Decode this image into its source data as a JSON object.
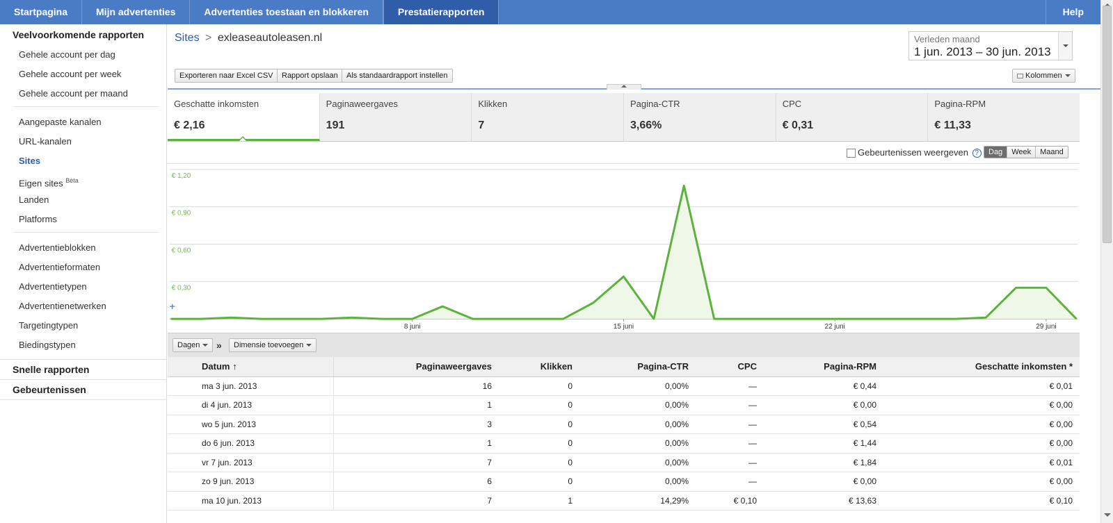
{
  "nav": {
    "tabs": [
      "Startpagina",
      "Mijn advertenties",
      "Advertenties toestaan en blokkeren",
      "Prestatierapporten"
    ],
    "active_tab": "Prestatierapporten",
    "help": "Help"
  },
  "sidebar": {
    "common_title": "Veelvoorkomende rapporten",
    "group1": [
      "Gehele account per dag",
      "Gehele account per week",
      "Gehele account per maand"
    ],
    "group2": [
      "Aangepaste kanalen",
      "URL-kanalen",
      "Sites"
    ],
    "own_sites": "Eigen sites",
    "own_sites_badge": "Bèta",
    "group2b": [
      "Landen",
      "Platforms"
    ],
    "group3": [
      "Advertentieblokken",
      "Advertentieformaten",
      "Advertentietypen",
      "Advertentienetwerken",
      "Targetingtypen",
      "Biedingstypen"
    ],
    "active_item": "Sites",
    "quick_reports": "Snelle rapporten",
    "events": "Gebeurtenissen"
  },
  "breadcrumb": {
    "parent": "Sites",
    "separator": ">",
    "current": "exleaseautoleasen.nl"
  },
  "daterange": {
    "label": "Verleden maand",
    "value": "1 jun. 2013 – 30 jun. 2013"
  },
  "toolbar": {
    "export": "Exporteren naar Excel CSV",
    "save": "Rapport opslaan",
    "default": "Als standaardrapport instellen",
    "columns": "Kolommen"
  },
  "scorecards": [
    {
      "label": "Geschatte inkomsten",
      "value": "€ 2,16"
    },
    {
      "label": "Paginaweergaves",
      "value": "191"
    },
    {
      "label": "Klikken",
      "value": "7"
    },
    {
      "label": "Pagina-CTR",
      "value": "3,66%"
    },
    {
      "label": "CPC",
      "value": "€ 0,31"
    },
    {
      "label": "Pagina-RPM",
      "value": "€ 11,33"
    }
  ],
  "chart_controls": {
    "events_label": "Gebeurtenissen weergeven",
    "help_glyph": "?",
    "granularity": [
      "Dag",
      "Week",
      "Maand"
    ],
    "active_granularity": "Dag"
  },
  "chart_data": {
    "type": "area",
    "x": [
      1,
      2,
      3,
      4,
      5,
      6,
      7,
      8,
      9,
      10,
      11,
      12,
      13,
      14,
      15,
      16,
      17,
      18,
      19,
      20,
      21,
      22,
      23,
      24,
      25,
      26,
      27,
      28,
      29,
      30
    ],
    "x_ticks": [
      {
        "day": 8,
        "label": "8 juni"
      },
      {
        "day": 15,
        "label": "15 juni"
      },
      {
        "day": 22,
        "label": "22 juni"
      },
      {
        "day": 29,
        "label": "29 juni"
      }
    ],
    "y_ticks": [
      {
        "value": 0.3,
        "label": "€ 0,30"
      },
      {
        "value": 0.6,
        "label": "€ 0,60"
      },
      {
        "value": 0.9,
        "label": "€ 0,90"
      },
      {
        "value": 1.2,
        "label": "€ 1,20"
      }
    ],
    "ylim": [
      0,
      1.2
    ],
    "series": [
      {
        "values": [
          0,
          0,
          0.01,
          0,
          0,
          0,
          0.01,
          0,
          0,
          0.1,
          0,
          0,
          0,
          0,
          0.13,
          0.34,
          0,
          1.07,
          0,
          0,
          0,
          0,
          0,
          0,
          0,
          0,
          0,
          0.01,
          0.25,
          0.25,
          0
        ]
      }
    ],
    "colors": {
      "line": "#5cb33b",
      "fill": "#eef7e8",
      "grid": "#d9d9d9",
      "tick": "#6cbf3f",
      "xtick": "#333333"
    }
  },
  "dimensions": {
    "days": "Dagen",
    "arrow": "»",
    "add": "Dimensie toevoegen"
  },
  "table": {
    "columns": [
      "Datum",
      "Paginaweergaves",
      "Klikken",
      "Pagina-CTR",
      "CPC",
      "Pagina-RPM",
      "Geschatte inkomsten *"
    ],
    "sort_glyph": "↑",
    "rows": [
      [
        "ma 3 jun. 2013",
        "16",
        "0",
        "0,00%",
        "—",
        "€ 0,44",
        "€ 0,01"
      ],
      [
        "di 4 jun. 2013",
        "1",
        "0",
        "0,00%",
        "—",
        "€ 0,00",
        "€ 0,00"
      ],
      [
        "wo 5 jun. 2013",
        "3",
        "0",
        "0,00%",
        "—",
        "€ 0,54",
        "€ 0,00"
      ],
      [
        "do 6 jun. 2013",
        "1",
        "0",
        "0,00%",
        "—",
        "€ 1,44",
        "€ 0,00"
      ],
      [
        "vr 7 jun. 2013",
        "7",
        "0",
        "0,00%",
        "—",
        "€ 1,84",
        "€ 0,01"
      ],
      [
        "zo 9 jun. 2013",
        "6",
        "0",
        "0,00%",
        "—",
        "€ 0,00",
        "€ 0,00"
      ],
      [
        "ma 10 jun. 2013",
        "7",
        "1",
        "14,29%",
        "€ 0,10",
        "€ 13,63",
        "€ 0,10"
      ]
    ]
  }
}
